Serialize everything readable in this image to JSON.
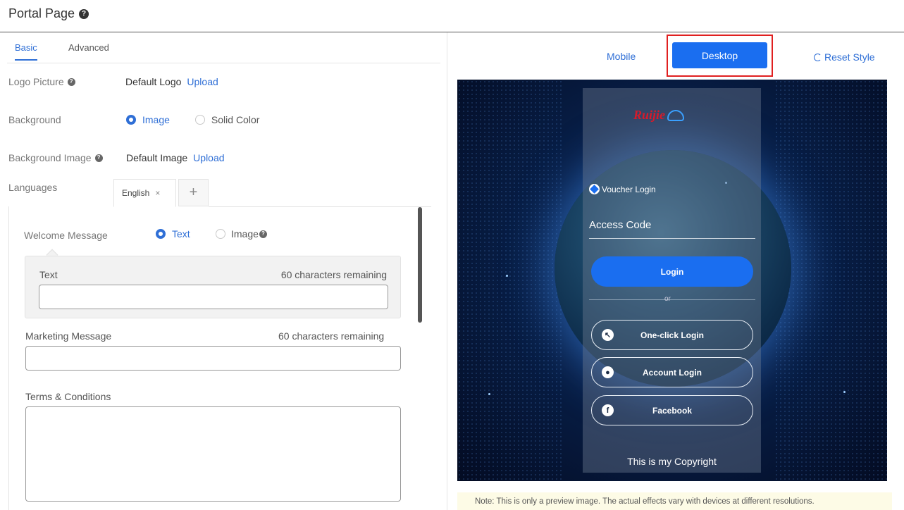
{
  "page": {
    "title": "Portal Page"
  },
  "tabs": {
    "basic": "Basic",
    "advanced": "Advanced"
  },
  "logo": {
    "label": "Logo Picture",
    "value": "Default Logo",
    "action": "Upload"
  },
  "background": {
    "label": "Background",
    "options": [
      "Image",
      "Solid Color"
    ],
    "selected": "Image"
  },
  "background_image": {
    "label": "Background Image",
    "value": "Default Image",
    "action": "Upload"
  },
  "languages": {
    "label": "Languages",
    "tabs": [
      "English"
    ],
    "close_glyph": "×",
    "add_glyph": "+"
  },
  "welcome": {
    "label": "Welcome Message",
    "options": [
      "Text",
      "Image"
    ],
    "selected": "Text",
    "text_label": "Text",
    "remaining": "60 characters remaining",
    "text_value": ""
  },
  "marketing": {
    "label": "Marketing Message",
    "remaining": "60 characters remaining",
    "value": ""
  },
  "terms": {
    "label": "Terms & Conditions",
    "value": ""
  },
  "view": {
    "mobile": "Mobile",
    "desktop": "Desktop",
    "selected": "Desktop",
    "reset": "Reset Style"
  },
  "preview": {
    "brand": "Ruijie",
    "voucher_login": "Voucher Login",
    "access_code": "Access Code",
    "login": "Login",
    "or": "or",
    "one_click": "One-click Login",
    "account_login": "Account Login",
    "facebook": "Facebook",
    "copyright": "This is my Copyright"
  },
  "note": "Note: This is only a preview image. The actual effects vary with devices at different resolutions.",
  "colors": {
    "accent": "#2f6fd6",
    "primary_button": "#1a6ef0",
    "highlight_border": "#e02020"
  }
}
